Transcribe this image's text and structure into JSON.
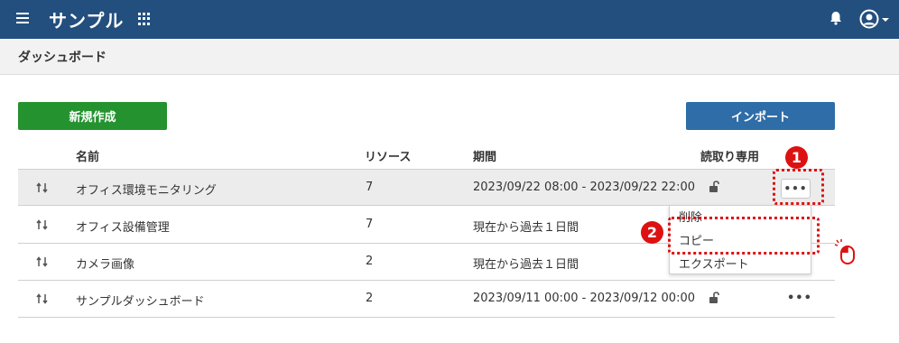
{
  "header": {
    "app_title": "サンプル"
  },
  "page": {
    "title": "ダッシュボード"
  },
  "toolbar": {
    "new_label": "新規作成",
    "import_label": "インポート"
  },
  "table": {
    "columns": {
      "name": "名前",
      "resource": "リソース",
      "period": "期間",
      "readonly": "読取り専用"
    },
    "rows": [
      {
        "name": "オフィス環境モニタリング",
        "resource": "7",
        "period": "2023/09/22 08:00 - 2023/09/22 22:00"
      },
      {
        "name": "オフィス設備管理",
        "resource": "7",
        "period": "現在から過去１日間"
      },
      {
        "name": "カメラ画像",
        "resource": "2",
        "period": "現在から過去１日間"
      },
      {
        "name": "サンプルダッシュボード",
        "resource": "2",
        "period": "2023/09/11 00:00 - 2023/09/12 00:00"
      }
    ]
  },
  "menu": {
    "more": "•••",
    "delete": "削除",
    "copy": "コピー",
    "export": "エクスポート"
  },
  "callouts": {
    "step1": "1",
    "step2": "2"
  },
  "colors": {
    "header": "#234f7e",
    "new_button": "#24922f",
    "import_button": "#2e6da8",
    "callout": "#dd1111"
  }
}
